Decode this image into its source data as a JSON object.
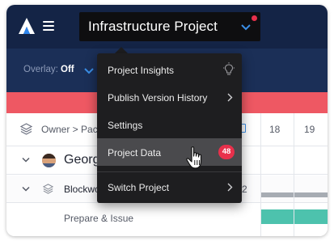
{
  "header": {
    "project_title": "Infrastructure Project",
    "notification_color": "#e8304b",
    "brand_color": "#142446"
  },
  "toolbar": {
    "overlay_label": "Overlay:",
    "overlay_value": "Off"
  },
  "grid": {
    "group_header": "Owner > Pac",
    "days": [
      "18",
      "19"
    ],
    "rows": [
      {
        "type": "person",
        "label": "Georg"
      },
      {
        "type": "group",
        "label": "Blockwo",
        "count": "2"
      },
      {
        "type": "task",
        "label": "Prepare & Issue"
      }
    ]
  },
  "dropdown": {
    "items": [
      {
        "label": "Project Insights",
        "icon": "lightbulb-icon"
      },
      {
        "label": "Publish Version History",
        "icon": "chevron-right-icon"
      },
      {
        "label": "Settings"
      },
      {
        "label": "Project Data",
        "badge": "48",
        "active": true
      },
      {
        "label": "Switch Project",
        "icon": "chevron-right-icon"
      }
    ]
  }
}
